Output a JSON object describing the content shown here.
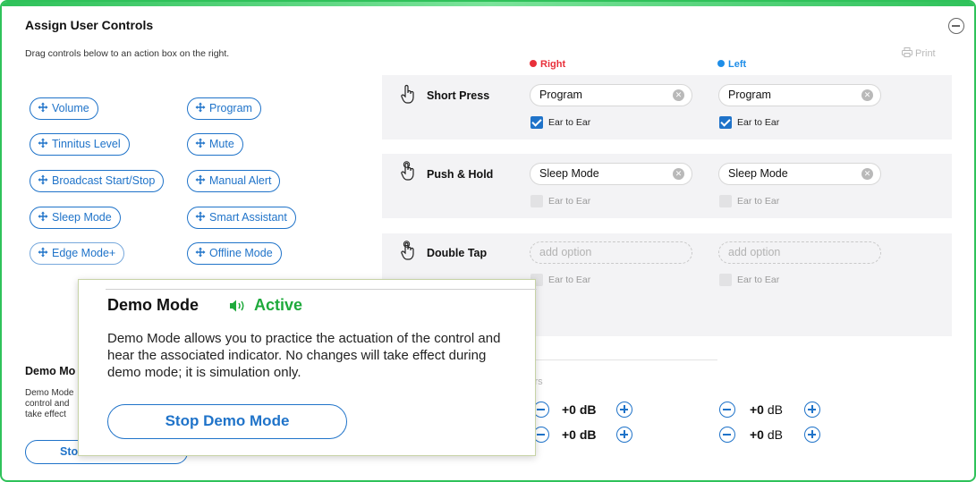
{
  "panel": {
    "title": "Assign User Controls",
    "subtitle": "Drag controls below to an action box on the right.",
    "print_label": "Print"
  },
  "controls": [
    "Volume",
    "Program",
    "Tinnitus Level",
    "Mute",
    "Broadcast Start/Stop",
    "Manual Alert",
    "Sleep Mode",
    "Smart Assistant",
    "Edge Mode+",
    "Offline Mode"
  ],
  "columns": {
    "right": {
      "label": "Right",
      "color": "#e8303a"
    },
    "left": {
      "label": "Left",
      "color": "#1f8ee8"
    }
  },
  "actions": [
    {
      "name": "Short Press",
      "right": {
        "value": "Program",
        "ear_label": "Ear to Ear",
        "ear_checked": true
      },
      "left": {
        "value": "Program",
        "ear_label": "Ear to Ear",
        "ear_checked": true
      }
    },
    {
      "name": "Push & Hold",
      "right": {
        "value": "Sleep Mode",
        "ear_label": "Ear to Ear",
        "ear_checked": false
      },
      "left": {
        "value": "Sleep Mode",
        "ear_label": "Ear to Ear",
        "ear_checked": false
      }
    },
    {
      "name": "Double Tap",
      "right": {
        "placeholder": "add option",
        "ear_label": "Ear to Ear",
        "ear_checked": false
      },
      "left": {
        "placeholder": "add option",
        "ear_label": "Ear to Ear",
        "ear_checked": false
      }
    }
  ],
  "indicators": {
    "title_partial": "ndicators",
    "right": [
      {
        "sign": "+0",
        "unit": "dB"
      },
      {
        "sign": "+0",
        "unit": "dB"
      }
    ],
    "left": [
      {
        "sign": "+0",
        "unit": "dB"
      },
      {
        "sign": "+0",
        "unit": "dB"
      }
    ]
  },
  "background_demo": {
    "title_partial": "Demo Mo",
    "text_partial": "Demo Mode control and take effect",
    "stop_partial": "Sto"
  },
  "demo_popup": {
    "title": "Demo Mode",
    "status": "Active",
    "status_color": "#1faa3c",
    "description": "Demo Mode allows you to practice the actuation of the control and hear the associated indicator. No changes will take effect during demo mode; it is simulation only.",
    "stop_button": "Stop Demo Mode"
  },
  "colors": {
    "accent": "#1f73c9",
    "frame": "#2fc25a"
  }
}
